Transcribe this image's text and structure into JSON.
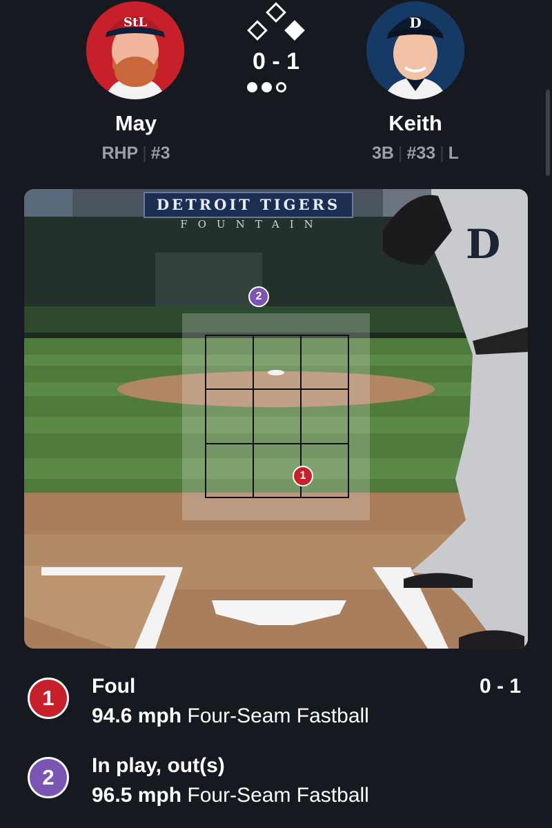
{
  "matchup": {
    "count": "0 - 1",
    "bases": [
      "empty",
      "empty",
      "occupied"
    ],
    "outs": [
      "filled",
      "filled",
      "empty"
    ]
  },
  "pitcher": {
    "name": "May",
    "position": "RHP",
    "number": "#3",
    "cap_logo": "StL",
    "team_color": "#c8202b"
  },
  "batter": {
    "name": "Keith",
    "position": "3B",
    "number": "#33",
    "bats": "L",
    "cap_logo": "D",
    "team_color": "#163a66"
  },
  "stadium": {
    "sign_title": "DETROIT TIGERS",
    "sign_subtitle": "FOUNTAIN"
  },
  "pitches": [
    {
      "index": "1",
      "result": "Foul",
      "count": "0 - 1",
      "speed": "94.6 mph",
      "pitch_type": "Four-Seam Fastball",
      "color": "#c8202b"
    },
    {
      "index": "2",
      "result": "In play, out(s)",
      "count": "",
      "speed": "96.5 mph",
      "pitch_type": "Four-Seam Fastball",
      "color": "#7b55b3"
    }
  ]
}
